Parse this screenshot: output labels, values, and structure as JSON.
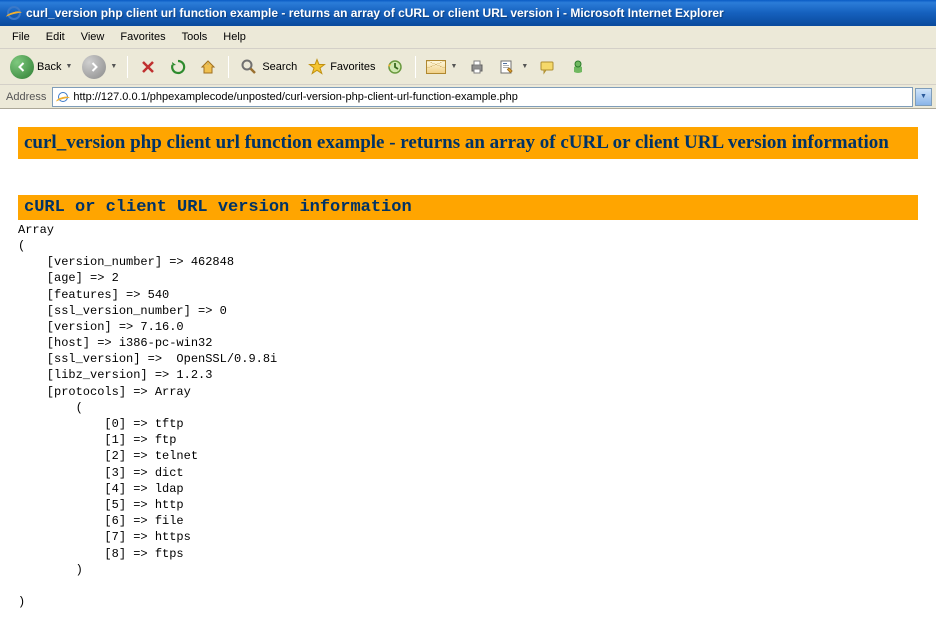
{
  "title": "curl_version php client url function example - returns an array of cURL or client URL version i - Microsoft Internet Explorer",
  "menu": {
    "file": "File",
    "edit": "Edit",
    "view": "View",
    "favorites": "Favorites",
    "tools": "Tools",
    "help": "Help"
  },
  "toolbar": {
    "back": "Back",
    "search": "Search",
    "favorites": "Favorites"
  },
  "address": {
    "label": "Address",
    "url": "http://127.0.0.1/phpexamplecode/unposted/curl-version-php-client-url-function-example.php"
  },
  "page": {
    "h1": "curl_version php client url function example - returns an array of cURL or client URL version information",
    "h2": "cURL or client URL version information",
    "pre": "Array\n(\n    [version_number] => 462848\n    [age] => 2\n    [features] => 540\n    [ssl_version_number] => 0\n    [version] => 7.16.0\n    [host] => i386-pc-win32\n    [ssl_version] =>  OpenSSL/0.9.8i\n    [libz_version] => 1.2.3\n    [protocols] => Array\n        (\n            [0] => tftp\n            [1] => ftp\n            [2] => telnet\n            [3] => dict\n            [4] => ldap\n            [5] => http\n            [6] => file\n            [7] => https\n            [8] => ftps\n        )\n\n)"
  }
}
